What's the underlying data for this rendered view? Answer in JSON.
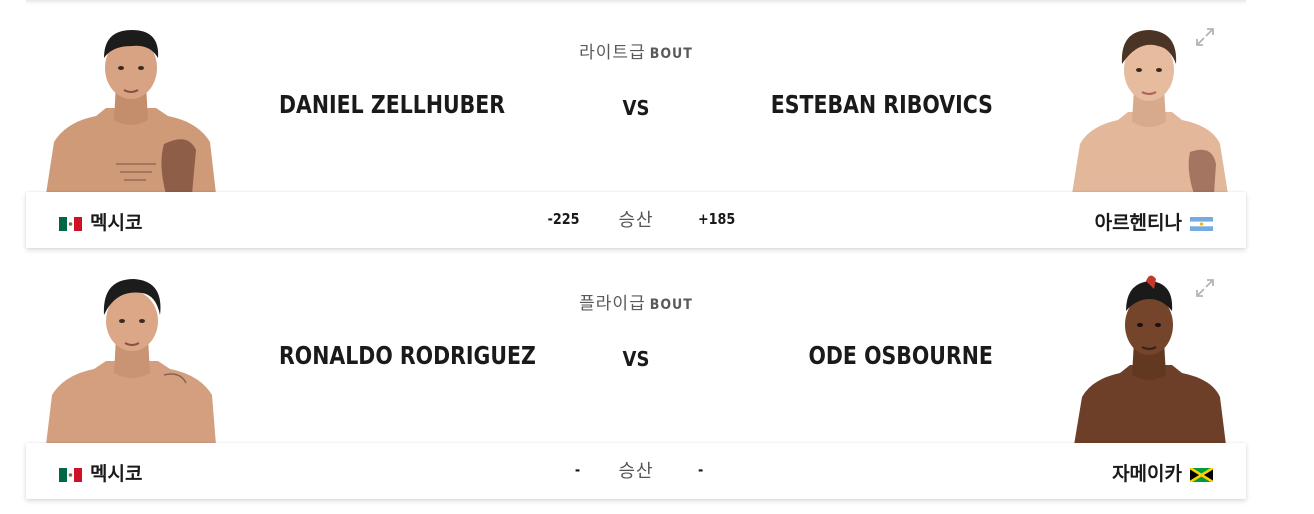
{
  "bouts": [
    {
      "weight_class": "라이트급",
      "bout_label": "BOUT",
      "red": {
        "name": "DANIEL ZELLHUBER",
        "country": "멕시코",
        "odds": "-225",
        "flag": "mexico-flag"
      },
      "vs": "VS",
      "blue": {
        "name": "ESTEBAN RIBOVICS",
        "country": "아르헨티나",
        "odds": "+185",
        "flag": "argentina-flag"
      },
      "odds_label": "승산"
    },
    {
      "weight_class": "플라이급",
      "bout_label": "BOUT",
      "red": {
        "name": "RONALDO RODRIGUEZ",
        "country": "멕시코",
        "odds": "-",
        "flag": "mexico-flag"
      },
      "vs": "VS",
      "blue": {
        "name": "ODE OSBOURNE",
        "country": "자메이카",
        "odds": "-",
        "flag": "jamaica-flag"
      },
      "odds_label": "승산"
    }
  ],
  "colors": {
    "text": "#1a1a1a",
    "muted": "#5a5a5a",
    "skin_light": "#d9a482",
    "skin_dark": "#6b3e26",
    "hair": "#1c1c1c"
  }
}
